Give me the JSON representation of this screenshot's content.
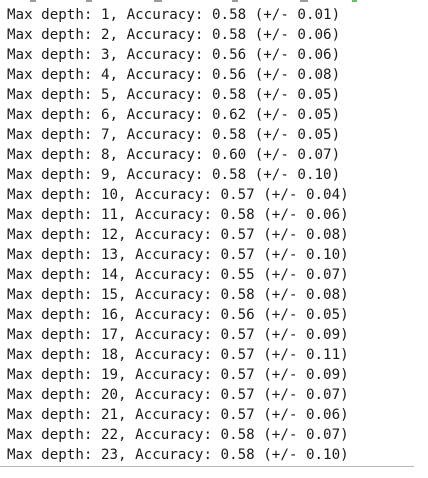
{
  "output": {
    "lines": [
      "Max depth: 1, Accuracy: 0.58 (+/- 0.01)",
      "Max depth: 2, Accuracy: 0.58 (+/- 0.06)",
      "Max depth: 3, Accuracy: 0.56 (+/- 0.06)",
      "Max depth: 4, Accuracy: 0.56 (+/- 0.08)",
      "Max depth: 5, Accuracy: 0.58 (+/- 0.05)",
      "Max depth: 6, Accuracy: 0.62 (+/- 0.05)",
      "Max depth: 7, Accuracy: 0.58 (+/- 0.05)",
      "Max depth: 8, Accuracy: 0.60 (+/- 0.07)",
      "Max depth: 9, Accuracy: 0.58 (+/- 0.10)",
      "Max depth: 10, Accuracy: 0.57 (+/- 0.04)",
      "Max depth: 11, Accuracy: 0.58 (+/- 0.06)",
      "Max depth: 12, Accuracy: 0.57 (+/- 0.08)",
      "Max depth: 13, Accuracy: 0.57 (+/- 0.10)",
      "Max depth: 14, Accuracy: 0.55 (+/- 0.07)",
      "Max depth: 15, Accuracy: 0.58 (+/- 0.08)",
      "Max depth: 16, Accuracy: 0.56 (+/- 0.05)",
      "Max depth: 17, Accuracy: 0.57 (+/- 0.09)",
      "Max depth: 18, Accuracy: 0.57 (+/- 0.11)",
      "Max depth: 19, Accuracy: 0.57 (+/- 0.09)",
      "Max depth: 20, Accuracy: 0.57 (+/- 0.07)",
      "Max depth: 21, Accuracy: 0.57 (+/- 0.06)",
      "Max depth: 22, Accuracy: 0.58 (+/- 0.07)",
      "Max depth: 23, Accuracy: 0.58 (+/- 0.10)"
    ]
  },
  "colors": {
    "text": "#1a1a1a",
    "background": "#ffffff",
    "rule": "#b5b5b5"
  }
}
